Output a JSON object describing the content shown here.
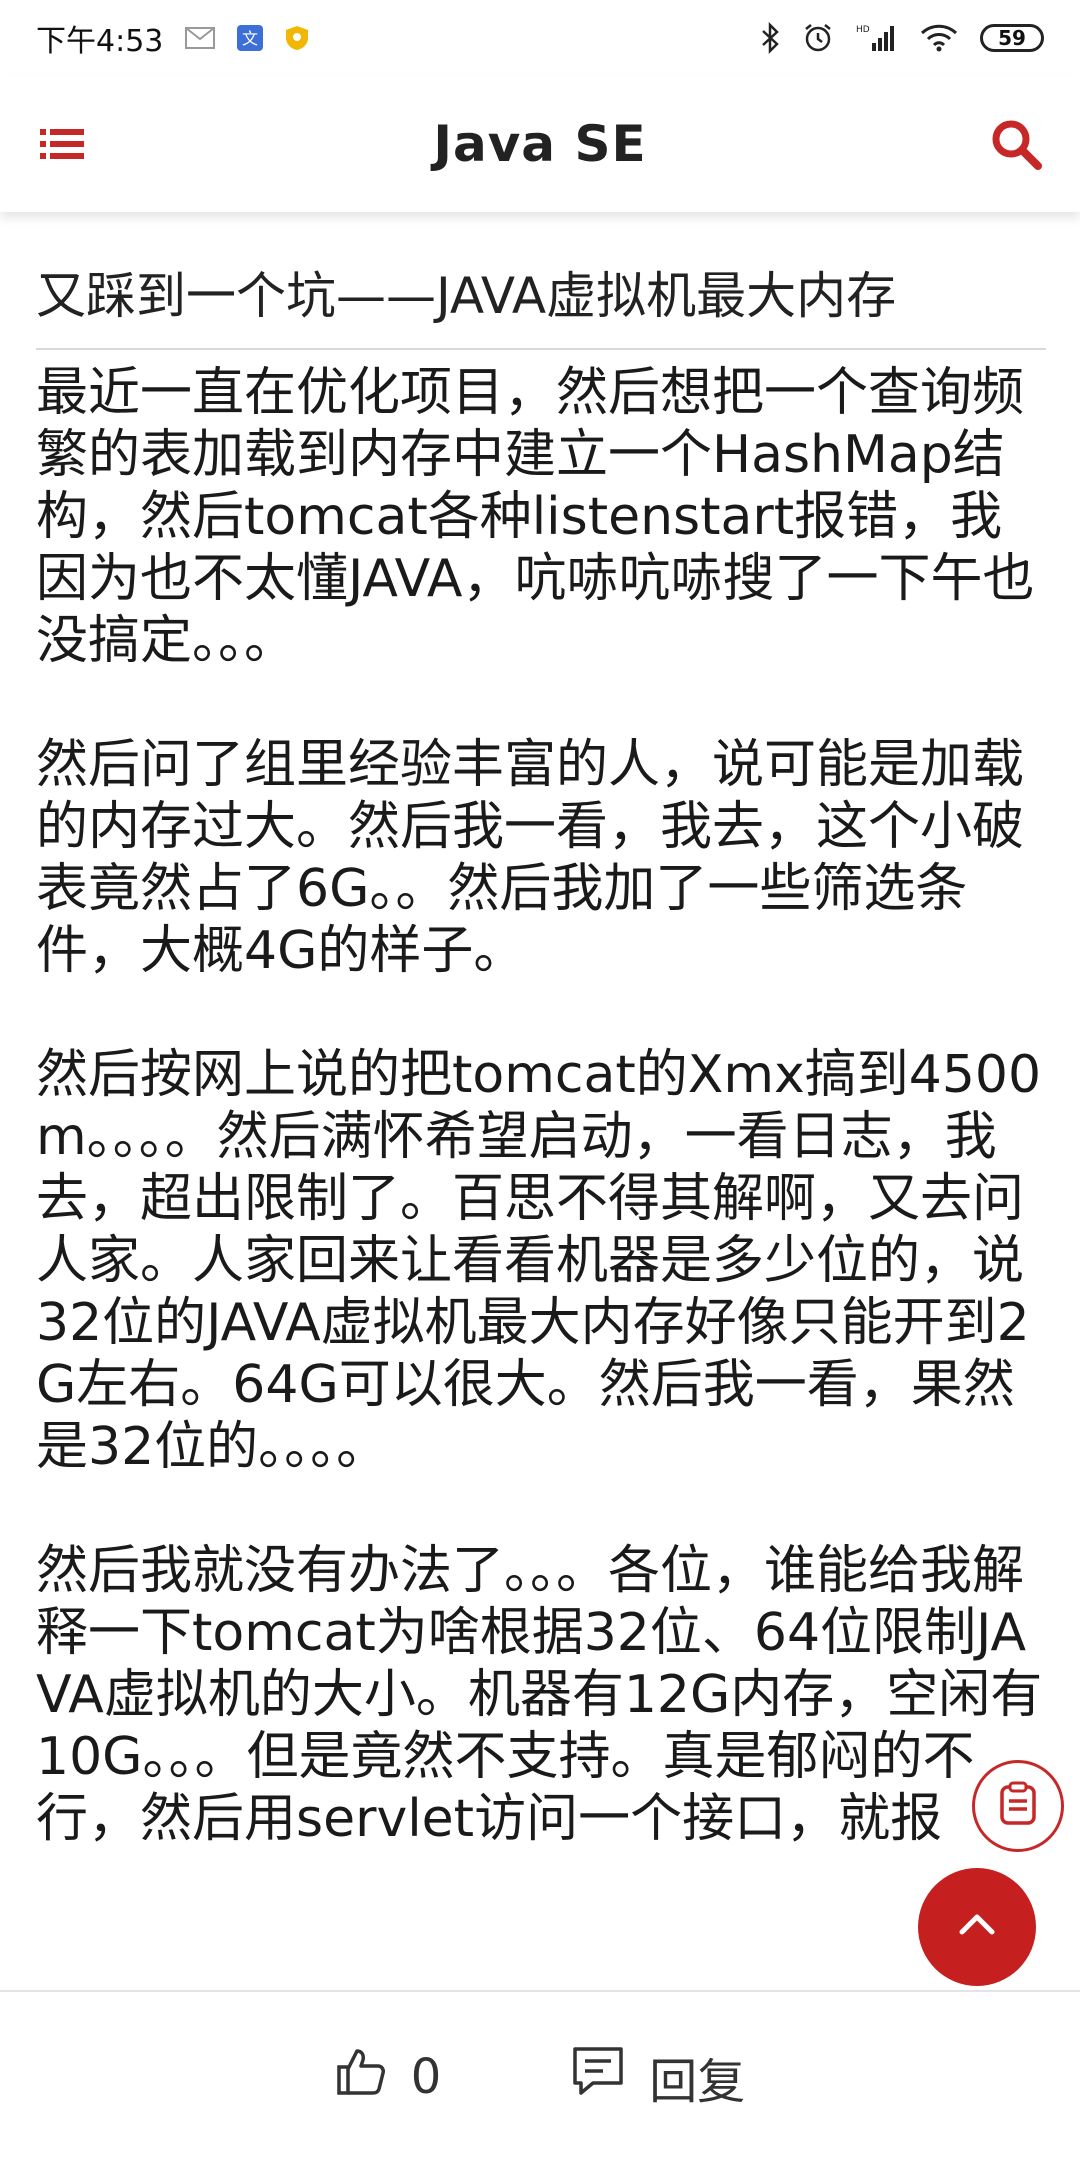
{
  "status_bar": {
    "time": "下午4:53",
    "battery": "59",
    "icons": [
      "mail-icon",
      "translate-icon",
      "shield-icon",
      "bluetooth-icon",
      "alarm-icon",
      "signal-icon",
      "wifi-icon"
    ]
  },
  "header": {
    "title": "Java SE",
    "menu_icon": "menu-list-icon",
    "search_icon": "search-icon",
    "accent": "#c62828"
  },
  "post": {
    "title": "又踩到一个坑——JAVA虚拟机最大内存",
    "body": "最近一直在优化项目，然后想把一个查询频繁的表加载到内存中建立一个HashMap结构，然后tomcat各种listenstart报错，我因为也不太懂JAVA，吭哧吭哧搜了一下午也没搞定。。。\n\n然后问了组里经验丰富的人，说可能是加载的内存过大。然后我一看，我去，这个小破表竟然占了6G。。然后我加了一些筛选条件，大概4G的样子。\n\n然后按网上说的把tomcat的Xmx搞到4500m。。。。然后满怀希望启动，一看日志，我去，超出限制了。百思不得其解啊，又去问人家。人家回来让看看机器是多少位的，说32位的JAVA虚拟机最大内存好像只能开到2G左右。64G可以很大。然后我一看，果然是32位的。。。。\n\n然后我就没有办法了。。。各位，谁能给我解释一下tomcat为啥根据32位、64位限制JAVA虚拟机的大小。机器有12G内存，空闲有10G。。。但是竟然不支持。真是郁闷的不行，然后用servlet访问一个接口，就报"
  },
  "bottom_bar": {
    "like_count": "0",
    "reply_label": "回复"
  }
}
